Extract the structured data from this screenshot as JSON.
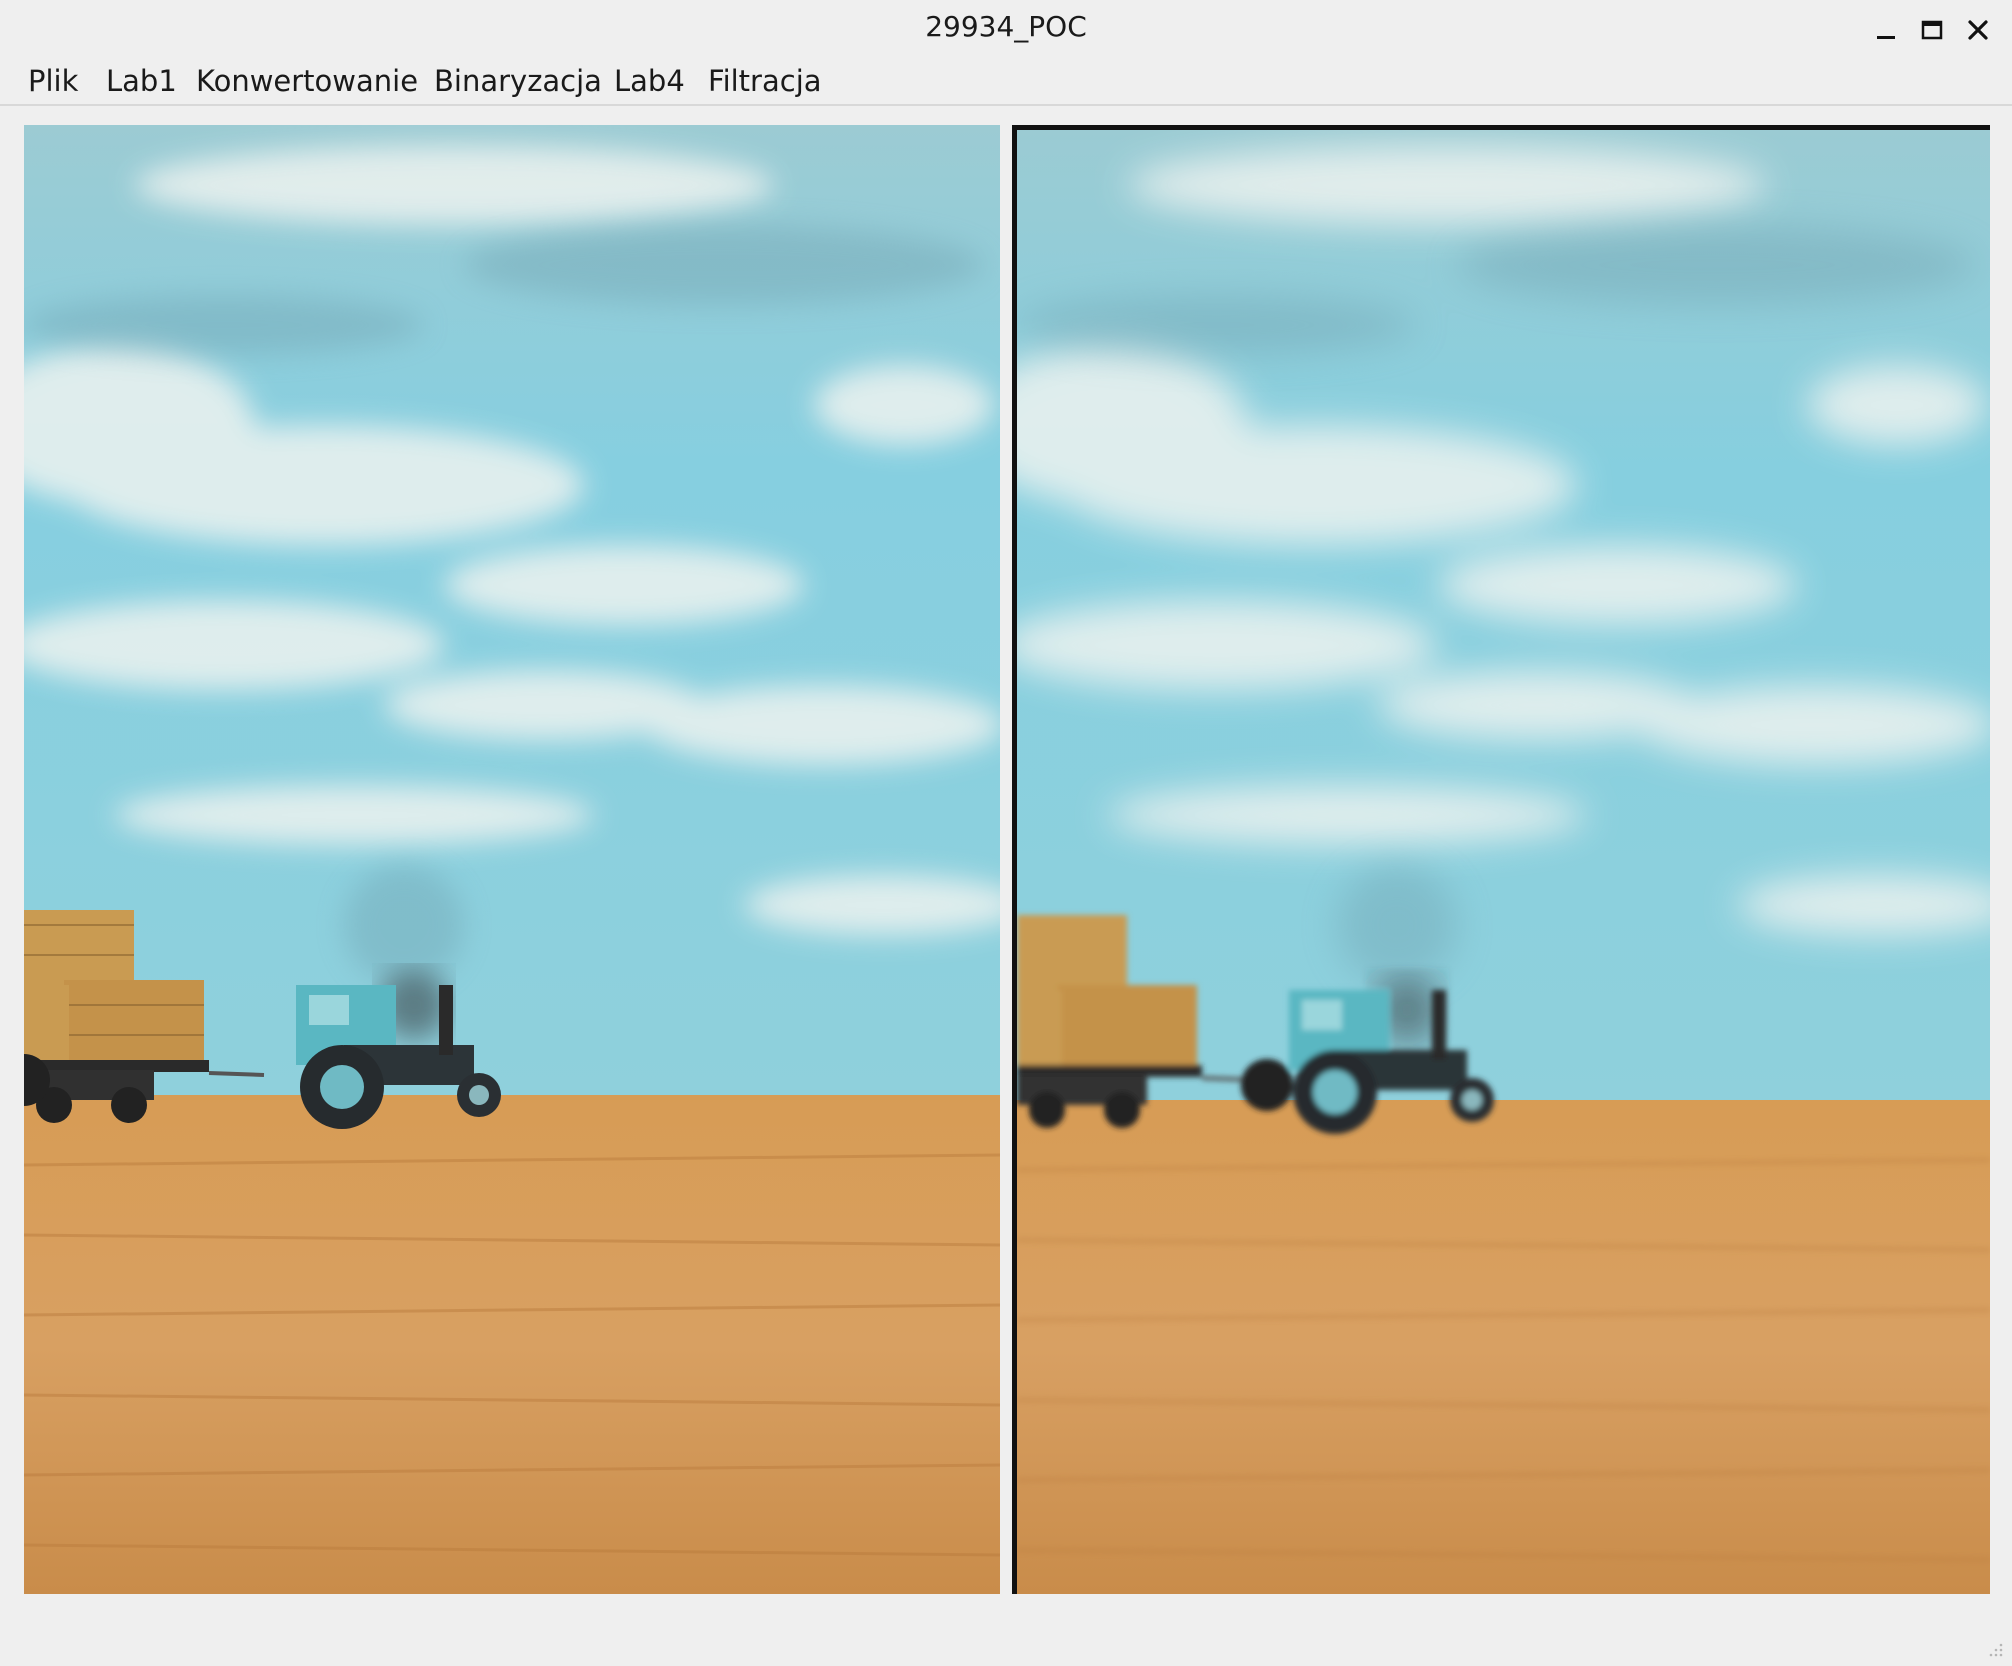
{
  "window": {
    "title": "29934_POC",
    "controls": {
      "minimize_icon": "minimize-icon",
      "maximize_icon": "maximize-icon",
      "close_icon": "close-icon"
    }
  },
  "menubar": {
    "items": [
      {
        "label": "Plik"
      },
      {
        "label": "Lab1"
      },
      {
        "label": "Konwertowanie"
      },
      {
        "label": "Binaryzacja"
      },
      {
        "label": "Lab4"
      },
      {
        "label": "Filtracja"
      }
    ]
  },
  "colors": {
    "sky_top": "#8fc8d6",
    "sky_mid": "#7fd0e0",
    "field": "#d39a55",
    "field_dark": "#b9783a",
    "tractor": "#5fb8c4",
    "hay": "#c79a4e"
  }
}
